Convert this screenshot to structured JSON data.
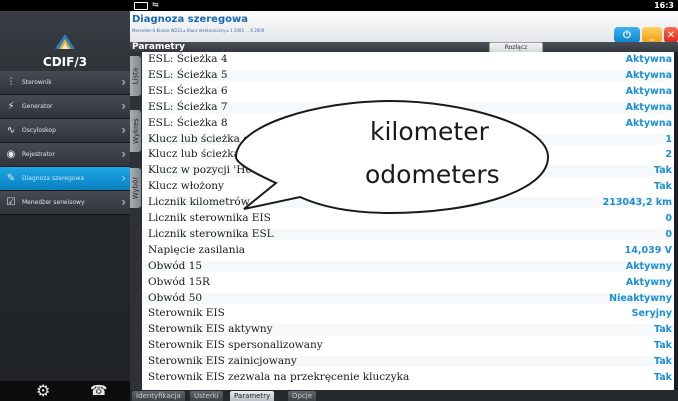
{
  "statusbar": {
    "clock": "16:3"
  },
  "app": {
    "name": "CDIF/3"
  },
  "sidebar": {
    "items": [
      {
        "label": "Sterownik",
        "icon": "sliders-icon",
        "active": false
      },
      {
        "label": "Generator",
        "icon": "lightning-icon",
        "active": false
      },
      {
        "label": "Oscyloskop",
        "icon": "waveform-icon",
        "active": false
      },
      {
        "label": "Rejestrator",
        "icon": "record-icon",
        "active": false
      },
      {
        "label": "Diagnoza szeregowa",
        "icon": "wrench-icon",
        "active": true
      },
      {
        "label": "Menedżer serwisowy",
        "icon": "checklist-icon",
        "active": false
      }
    ]
  },
  "header": {
    "title": "Diagnoza szeregowa",
    "subtitle": "Mercedes-S-Klasse W221 ▸ Klucz elektroniczny ▸ 1 2005 ... 6 2009"
  },
  "section": {
    "title": "Parametry",
    "disconnect_label": "Rozłącz"
  },
  "sidetabs": [
    "Lista",
    "Wykres",
    "Wybór"
  ],
  "rows": [
    {
      "param": "ESL: Ścieżka 4",
      "value": "Aktywna"
    },
    {
      "param": "ESL: Ścieżka 5",
      "value": "Aktywna"
    },
    {
      "param": "ESL: Ścieżka 6",
      "value": "Aktywna"
    },
    {
      "param": "ESL: Ścieżka 7",
      "value": "Aktywna"
    },
    {
      "param": "ESL: Ścieżka 8",
      "value": "Aktywna"
    },
    {
      "param": "Klucz lub ścieżka ostatnio użyta",
      "value": "1"
    },
    {
      "param": "Klucz lub ścieżka przed ostatnio użyta",
      "value": "2"
    },
    {
      "param": "Klucz w pozycji 'H0'",
      "value": "Tak"
    },
    {
      "param": "Klucz włożony",
      "value": "Tak"
    },
    {
      "param": "Licznik kilometrów",
      "value": "213043,2 km"
    },
    {
      "param": "Licznik sterownika EIS",
      "value": "0"
    },
    {
      "param": "Licznik sterownika ESL",
      "value": "0"
    },
    {
      "param": "Napięcie zasilania",
      "value": "14,039 V"
    },
    {
      "param": "Obwód 15",
      "value": "Aktywny"
    },
    {
      "param": "Obwód 15R",
      "value": "Aktywny"
    },
    {
      "param": "Obwód 50",
      "value": "Nieaktywny"
    },
    {
      "param": "Sterownik EIS",
      "value": "Seryjny"
    },
    {
      "param": "Sterownik EIS aktywny",
      "value": "Tak"
    },
    {
      "param": "Sterownik EIS spersonalizowany",
      "value": "Tak"
    },
    {
      "param": "Sterownik EIS zainicjowany",
      "value": "Tak"
    },
    {
      "param": "Sterownik EIS zezwala na przekręcenie kluczyka",
      "value": "Tak"
    }
  ],
  "bottomtabs": [
    {
      "label": "Identyfikacja",
      "active": false
    },
    {
      "label": "Usterki",
      "active": false
    },
    {
      "label": "Parametry",
      "active": true
    },
    {
      "label": "Opcje",
      "active": false
    }
  ],
  "callout": {
    "line1": "kilometer",
    "line2": "odometers"
  }
}
